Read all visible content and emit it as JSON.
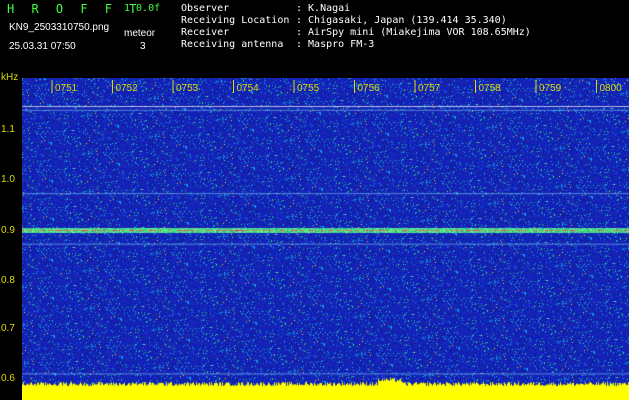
{
  "header": {
    "app_title": "H R O F F T",
    "version": "1.0.0f",
    "filename": "KN9_2503310750.png",
    "datetime": "25.03.31 07:50",
    "meteor_label": "meteor",
    "meteor_count": "3",
    "fields": [
      {
        "label": "Observer",
        "value": ": K.Nagai"
      },
      {
        "label": "Receiving Location",
        "value": ": Chigasaki, Japan (139.414 35.340)"
      },
      {
        "label": "Receiver",
        "value": ": AirSpy mini (Miakejima VOR 108.65MHz)"
      },
      {
        "label": "Receiving antenna",
        "value": ": Maspro FM-3"
      }
    ]
  },
  "y_axis": {
    "unit": "kHz",
    "ticks": [
      {
        "value": 1.1,
        "label": "1.1"
      },
      {
        "value": 1.0,
        "label": "1.0"
      },
      {
        "value": 0.9,
        "label": "0.9"
      },
      {
        "value": 0.8,
        "label": "0.8"
      },
      {
        "value": 0.7,
        "label": "0.7"
      },
      {
        "value": 0.6,
        "label": "0.6"
      }
    ]
  },
  "time_axis": {
    "labels": [
      "0751",
      "0752",
      "0753",
      "0754",
      "0755",
      "0756",
      "0757",
      "0758",
      "0759",
      "0800"
    ]
  },
  "colors": {
    "background_noise": "#1a2ab8",
    "carrier_line": "#ff3030",
    "signal_green": "#33ff66",
    "axis_label": "#dddd00",
    "baseline_yellow": "#ffff00",
    "header_green": "#3dff3d"
  }
}
